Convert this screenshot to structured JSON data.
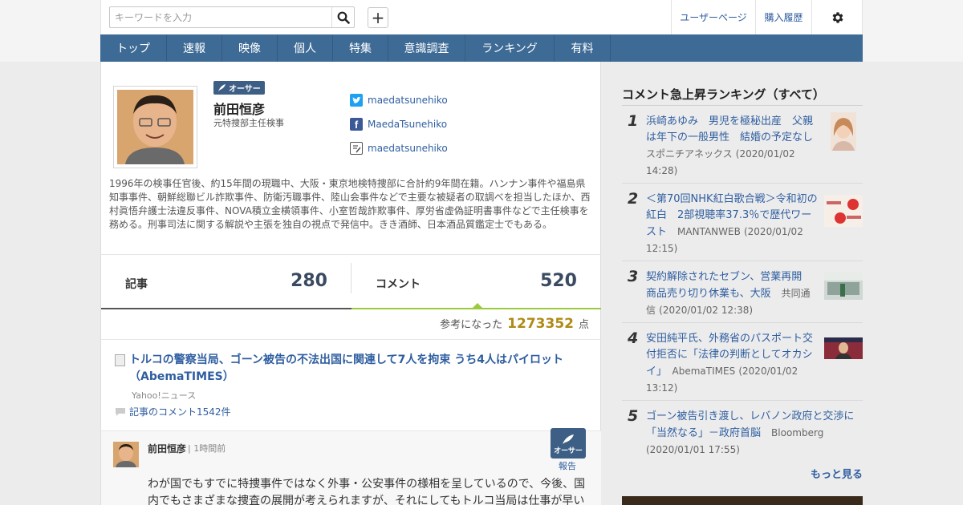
{
  "header": {
    "search_placeholder": "キーワードを入力",
    "search_icon": "search-icon",
    "plus_icon": "plus-icon",
    "user_page_label": "ユーザーページ",
    "purchase_history_label": "購入履歴",
    "settings_icon": "gear-icon"
  },
  "nav": {
    "items": [
      "トップ",
      "速報",
      "映像",
      "個人",
      "特集",
      "意識調査",
      "ランキング",
      "有料"
    ]
  },
  "profile": {
    "owner_badge": "オーサー",
    "name": "前田恒彦",
    "title": "元特捜部主任検事",
    "social": {
      "twitter": "maedatsunehiko",
      "facebook": "MaedaTsunehiko",
      "blog": "maedatsunehiko"
    },
    "bio": "1996年の検事任官後、約15年間の現職中、大阪・東京地検特捜部に合計約9年間在籍。ハンナン事件や福島県知事事件、朝鮮総聯ビル詐欺事件、防衛汚職事件、陸山会事件などで主要な被疑者の取調べを担当したほか、西村眞悟弁護士法違反事件、NOVA積立金横領事件、小室哲哉詐欺事件、厚労省虚偽証明書事件などで主任検事を務める。刑事司法に関する解説や主張を独自の視点で発信中。きき酒師、日本酒品質鑑定士でもある。"
  },
  "stats": {
    "articles_label": "記事",
    "articles_count": "280",
    "comments_label": "コメント",
    "comments_count": "520",
    "helpful_label": "参考になった",
    "helpful_points": "1273352",
    "helpful_unit": "点"
  },
  "article": {
    "title": "トルコの警察当局、ゴーン被告の不法出国に関連して7人を拘束 うち4人はパイロット（AbemaTIMES）",
    "source": "Yahoo!ニュース",
    "comment_link": "記事のコメント1542件"
  },
  "comment": {
    "author": "前田恒彦",
    "time": "1時間前",
    "badge": "オーサー",
    "report_label": "報告",
    "body": "わが国でもすでに特捜事件ではなく外事・公安事件の様相を呈しているので、今後、国内でもさまざまな捜査の展開が考えられますが、それにしてもトルコ当局は仕事が早い"
  },
  "sidebar": {
    "heading": "コメント急上昇ランキング（すべて）",
    "more_label": "もっと見る",
    "ranking": [
      {
        "rank": "1",
        "title": "浜崎あゆみ　男児を極秘出産　父親は年下の一般男性　結婚の予定なし",
        "source": "スポニチアネックス",
        "date": "(2020/01/02 14:28)"
      },
      {
        "rank": "2",
        "title": "＜第70回NHK紅白歌合戦＞令和初の紅白　2部視聴率37.3％で歴代ワースト",
        "source": "MANTANWEB",
        "date": "(2020/01/02 12:15)"
      },
      {
        "rank": "3",
        "title": "契約解除されたセブン、営業再開　商品売り切り休業も、大阪",
        "source": "共同通信",
        "date": "(2020/01/02 12:38)"
      },
      {
        "rank": "4",
        "title": "安田純平氏、外務省のパスポート交付拒否に「法律の判断としてオカシイ」",
        "source": "AbemaTIMES",
        "date": "(2020/01/02 13:12)"
      },
      {
        "rank": "5",
        "title": "ゴーン被告引き渡し、レバノン政府と交渉に「当然なる」－政府首脳",
        "source": "Bloomberg",
        "date": "(2020/01/01 17:55)"
      }
    ]
  }
}
